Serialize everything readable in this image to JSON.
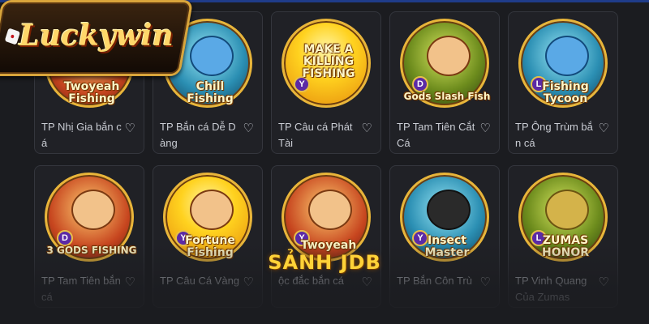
{
  "brand": {
    "logo_text": "Luckywin"
  },
  "overlay": {
    "title": "SẢNH JDB"
  },
  "games": [
    {
      "title": "Twoyeah\nFishing",
      "caption": "TP Nhị Gia bắn c\ná",
      "badge": "",
      "theme": "red",
      "icon": "twoyeah-fishing-icon"
    },
    {
      "title": "Chill\nFishing",
      "caption": "TP Bắn cá Dễ D\nàng",
      "badge": "",
      "theme": "teal",
      "icon": "shark-icon"
    },
    {
      "title": "MAKE A\nKILLING\nFISHING",
      "caption": "TP Câu cá Phát\nTài",
      "badge": "Y",
      "theme": "gold",
      "icon": "make-a-killing-icon"
    },
    {
      "title": "Gods Slash Fish",
      "caption": "TP Tam Tiên Cắt\nCá",
      "badge": "D",
      "theme": "green",
      "icon": "gods-slash-fish-icon"
    },
    {
      "title": "Fishing\nTycoon",
      "caption": "TP Ông Trùm bắ\nn cá",
      "badge": "L",
      "theme": "teal",
      "icon": "fishing-tycoon-icon"
    },
    {
      "title": "3 GODS FISHING",
      "caption": "TP Tam Tiên bắn\ncá",
      "badge": "D",
      "theme": "red",
      "icon": "three-gods-icon"
    },
    {
      "title": "Fortune\nFishing",
      "caption": "TP Câu Cá Vàng",
      "badge": "Y",
      "theme": "gold",
      "icon": "fortune-fishing-icon"
    },
    {
      "title": "Twoyeah",
      "caption": "ộc đắc bắn cá",
      "badge": "Y",
      "theme": "red",
      "icon": "twoyeah-jackpot-icon"
    },
    {
      "title": "Insect\nMaster",
      "caption": "TP Bắn Côn Trù",
      "badge": "Y",
      "theme": "teal",
      "icon": "insect-master-icon"
    },
    {
      "title": "ZUMAS\nHONOR",
      "caption": "TP Vinh Quang\nCủa Zumas",
      "badge": "L",
      "theme": "green",
      "icon": "zumas-honor-icon"
    }
  ],
  "icons": {
    "favorite": "heart-outline-icon"
  },
  "colors": {
    "accent": "#ffd238",
    "card_border": "#34363d",
    "background": "#1b1c20"
  }
}
